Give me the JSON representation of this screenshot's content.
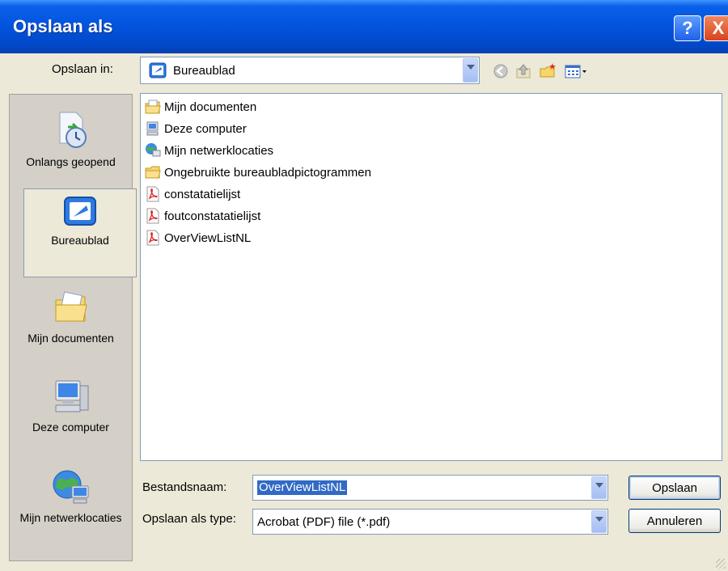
{
  "window": {
    "title": "Opslaan als",
    "help_symbol": "?",
    "close_symbol": "X"
  },
  "save_in": {
    "label": "Opslaan in:",
    "value": "Bureaublad",
    "icon": "desktop-icon"
  },
  "toolbar": {
    "items": [
      "back-icon",
      "up-folder-icon",
      "new-folder-icon",
      "view-menu-icon"
    ]
  },
  "places": [
    {
      "label": "Onlangs geopend",
      "icon": "recent-documents-icon",
      "selected": false
    },
    {
      "label": "Bureaublad",
      "icon": "desktop-icon",
      "selected": true
    },
    {
      "label": "Mijn documenten",
      "icon": "my-documents-icon",
      "selected": false
    },
    {
      "label": "Deze computer",
      "icon": "my-computer-icon",
      "selected": false
    },
    {
      "label": "Mijn netwerklocaties",
      "icon": "network-places-icon",
      "selected": false
    }
  ],
  "files": [
    {
      "name": "Mijn documenten",
      "icon": "my-documents-icon"
    },
    {
      "name": "Deze computer",
      "icon": "my-computer-icon"
    },
    {
      "name": "Mijn netwerklocaties",
      "icon": "network-places-icon"
    },
    {
      "name": "Ongebruikte bureaubladpictogrammen",
      "icon": "folder-icon"
    },
    {
      "name": "constatatielijst",
      "icon": "pdf-file-icon"
    },
    {
      "name": "foutconstatatielijst",
      "icon": "pdf-file-icon"
    },
    {
      "name": "OverViewListNL",
      "icon": "pdf-file-icon"
    }
  ],
  "filename": {
    "label": "Bestandsnaam:",
    "value": "OverViewListNL"
  },
  "filetype": {
    "label": "Opslaan als type:",
    "value": "Acrobat (PDF) file (*.pdf)"
  },
  "buttons": {
    "save": "Opslaan",
    "cancel": "Annuleren"
  },
  "colors": {
    "titlebar": "#0355DF",
    "face": "#ECE9D8",
    "selection": "#316AC5"
  }
}
